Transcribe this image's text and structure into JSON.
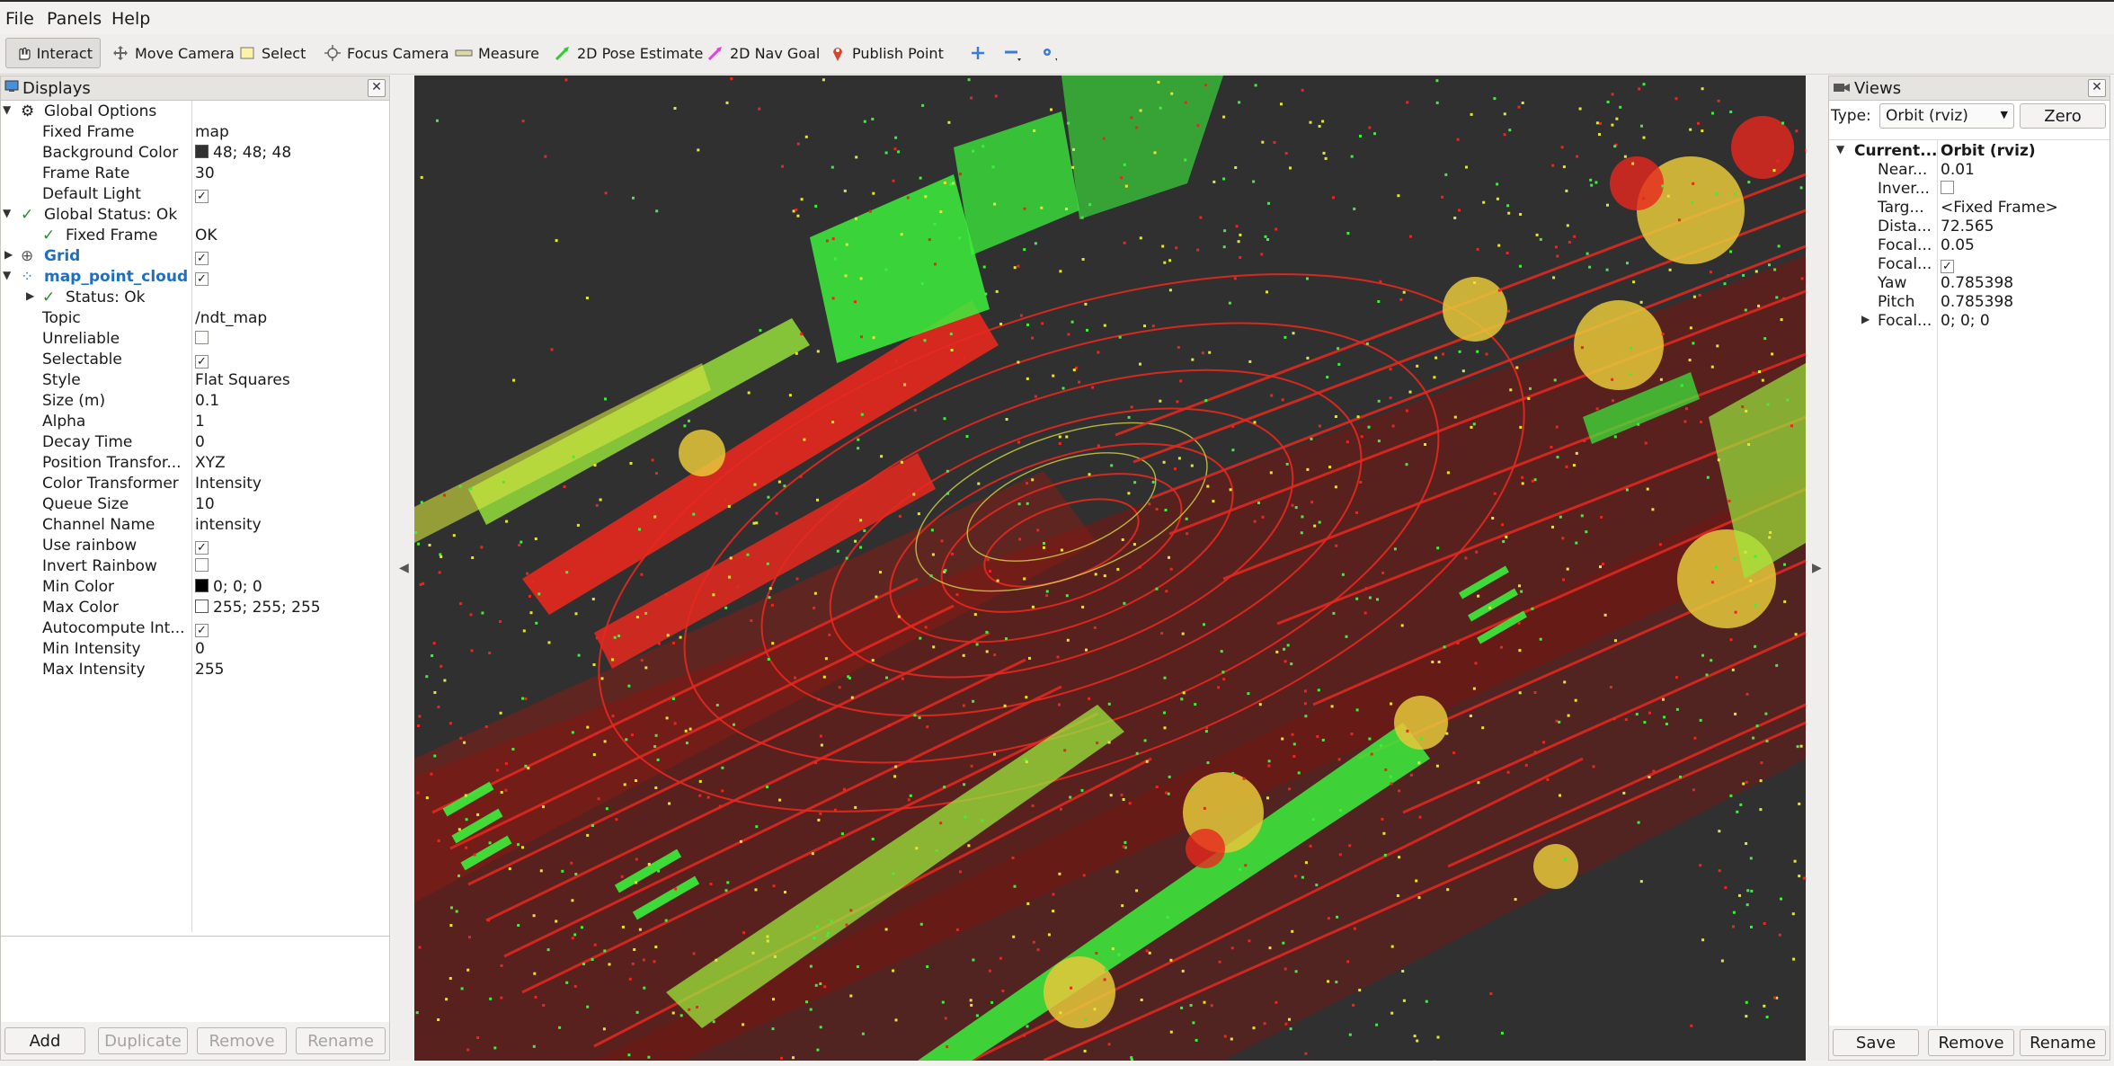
{
  "menu": {
    "file": "File",
    "panels": "Panels",
    "help": "Help"
  },
  "toolbar": {
    "interact": "Interact",
    "move_camera": "Move Camera",
    "select": "Select",
    "focus_camera": "Focus Camera",
    "measure": "Measure",
    "pose_estimate": "2D Pose Estimate",
    "nav_goal": "2D Nav Goal",
    "publish_point": "Publish Point"
  },
  "displays": {
    "title": "Displays",
    "global_options": "Global Options",
    "fixed_frame_k": "Fixed Frame",
    "fixed_frame_v": "map",
    "bg_color_k": "Background Color",
    "bg_color_v": "48; 48; 48",
    "frame_rate_k": "Frame Rate",
    "frame_rate_v": "30",
    "default_light_k": "Default Light",
    "global_status": "Global Status: Ok",
    "gs_fixed_frame_k": "Fixed Frame",
    "gs_fixed_frame_v": "OK",
    "grid": "Grid",
    "cloud": "map_point_cloud",
    "status_ok": "Status: Ok",
    "topic_k": "Topic",
    "topic_v": "/ndt_map",
    "unreliable_k": "Unreliable",
    "selectable_k": "Selectable",
    "style_k": "Style",
    "style_v": "Flat Squares",
    "size_k": "Size (m)",
    "size_v": "0.1",
    "alpha_k": "Alpha",
    "alpha_v": "1",
    "decay_k": "Decay Time",
    "decay_v": "0",
    "pos_tf_k": "Position Transfor...",
    "pos_tf_v": "XYZ",
    "color_tf_k": "Color Transformer",
    "color_tf_v": "Intensity",
    "queue_k": "Queue Size",
    "queue_v": "10",
    "channel_k": "Channel Name",
    "channel_v": "intensity",
    "rainbow_k": "Use rainbow",
    "invert_k": "Invert Rainbow",
    "min_color_k": "Min Color",
    "min_color_v": "0; 0; 0",
    "max_color_k": "Max Color",
    "max_color_v": "255; 255; 255",
    "autocompute_k": "Autocompute Int...",
    "min_int_k": "Min Intensity",
    "min_int_v": "0",
    "max_int_k": "Max Intensity",
    "max_int_v": "255",
    "add": "Add",
    "duplicate": "Duplicate",
    "remove": "Remove",
    "rename": "Rename"
  },
  "views": {
    "title": "Views",
    "type_label": "Type:",
    "type_value": "Orbit (rviz)",
    "zero": "Zero",
    "current_k": "Current...",
    "current_v": "Orbit (rviz)",
    "near_k": "Near...",
    "near_v": "0.01",
    "inver_k": "Inver...",
    "targ_k": "Targ...",
    "targ_v": "<Fixed Frame>",
    "dista_k": "Dista...",
    "dista_v": "72.565",
    "focal1_k": "Focal...",
    "focal1_v": "0.05",
    "focal2_k": "Focal...",
    "yaw_k": "Yaw",
    "yaw_v": "0.785398",
    "pitch_k": "Pitch",
    "pitch_v": "0.785398",
    "focal3_k": "Focal...",
    "focal3_v": "0; 0; 0",
    "save": "Save",
    "remove": "Remove",
    "rename": "Rename"
  },
  "colors": {
    "viewport_bg": "#303030",
    "red_points": "#e8281e",
    "green_points": "#3cf03c",
    "yellow_points": "#e6e632"
  }
}
